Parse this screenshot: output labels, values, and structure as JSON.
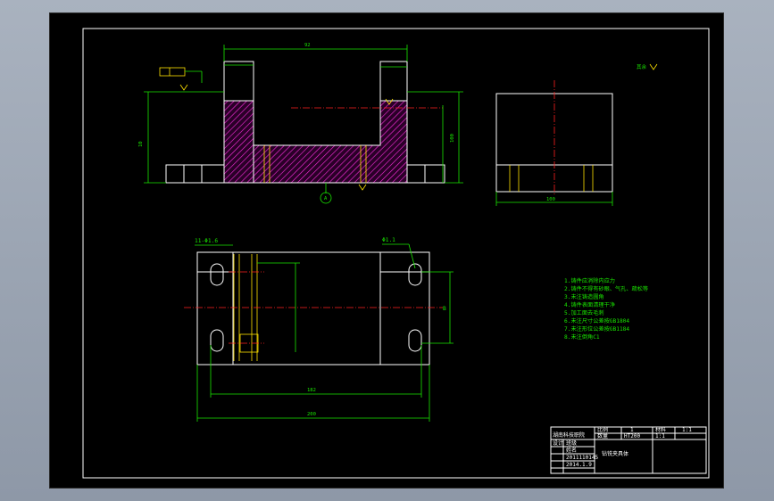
{
  "drawing": {
    "dims": {
      "top_width": "92",
      "left_height": "10",
      "right_height": "100",
      "side_width": "100",
      "plan_inner": "182",
      "plan_outer": "200"
    },
    "labels": {
      "datum_a": "A",
      "datum_b": "B",
      "section_mark": "A",
      "roughness_note": "其余",
      "plan_note": "11-Φ1.6",
      "hole_note": "Φ1.1"
    },
    "notes": [
      "1.铸件应消除内应力",
      "2.铸件不得有砂眼、气孔、疏松等",
      "3.未注铸造圆角",
      "4.铸件表面清理干净",
      "5.加工面去毛刺",
      "6.未注尺寸公差按GB1804",
      "7.未注形位公差按GB1184",
      "8.未注倒角C1"
    ],
    "title_block": {
      "part_name": "钻铣夹具体",
      "company": "湖南科技职院",
      "class": "班级",
      "name": "姓名",
      "id": "2011110145",
      "date": "2014.1.9",
      "material": "HT200",
      "scale": "1:1",
      "scale_label": "比例",
      "qty_label": "数量",
      "qty": "1",
      "drawing_no": "材料",
      "sheet": "1:1",
      "design": "设计"
    }
  }
}
